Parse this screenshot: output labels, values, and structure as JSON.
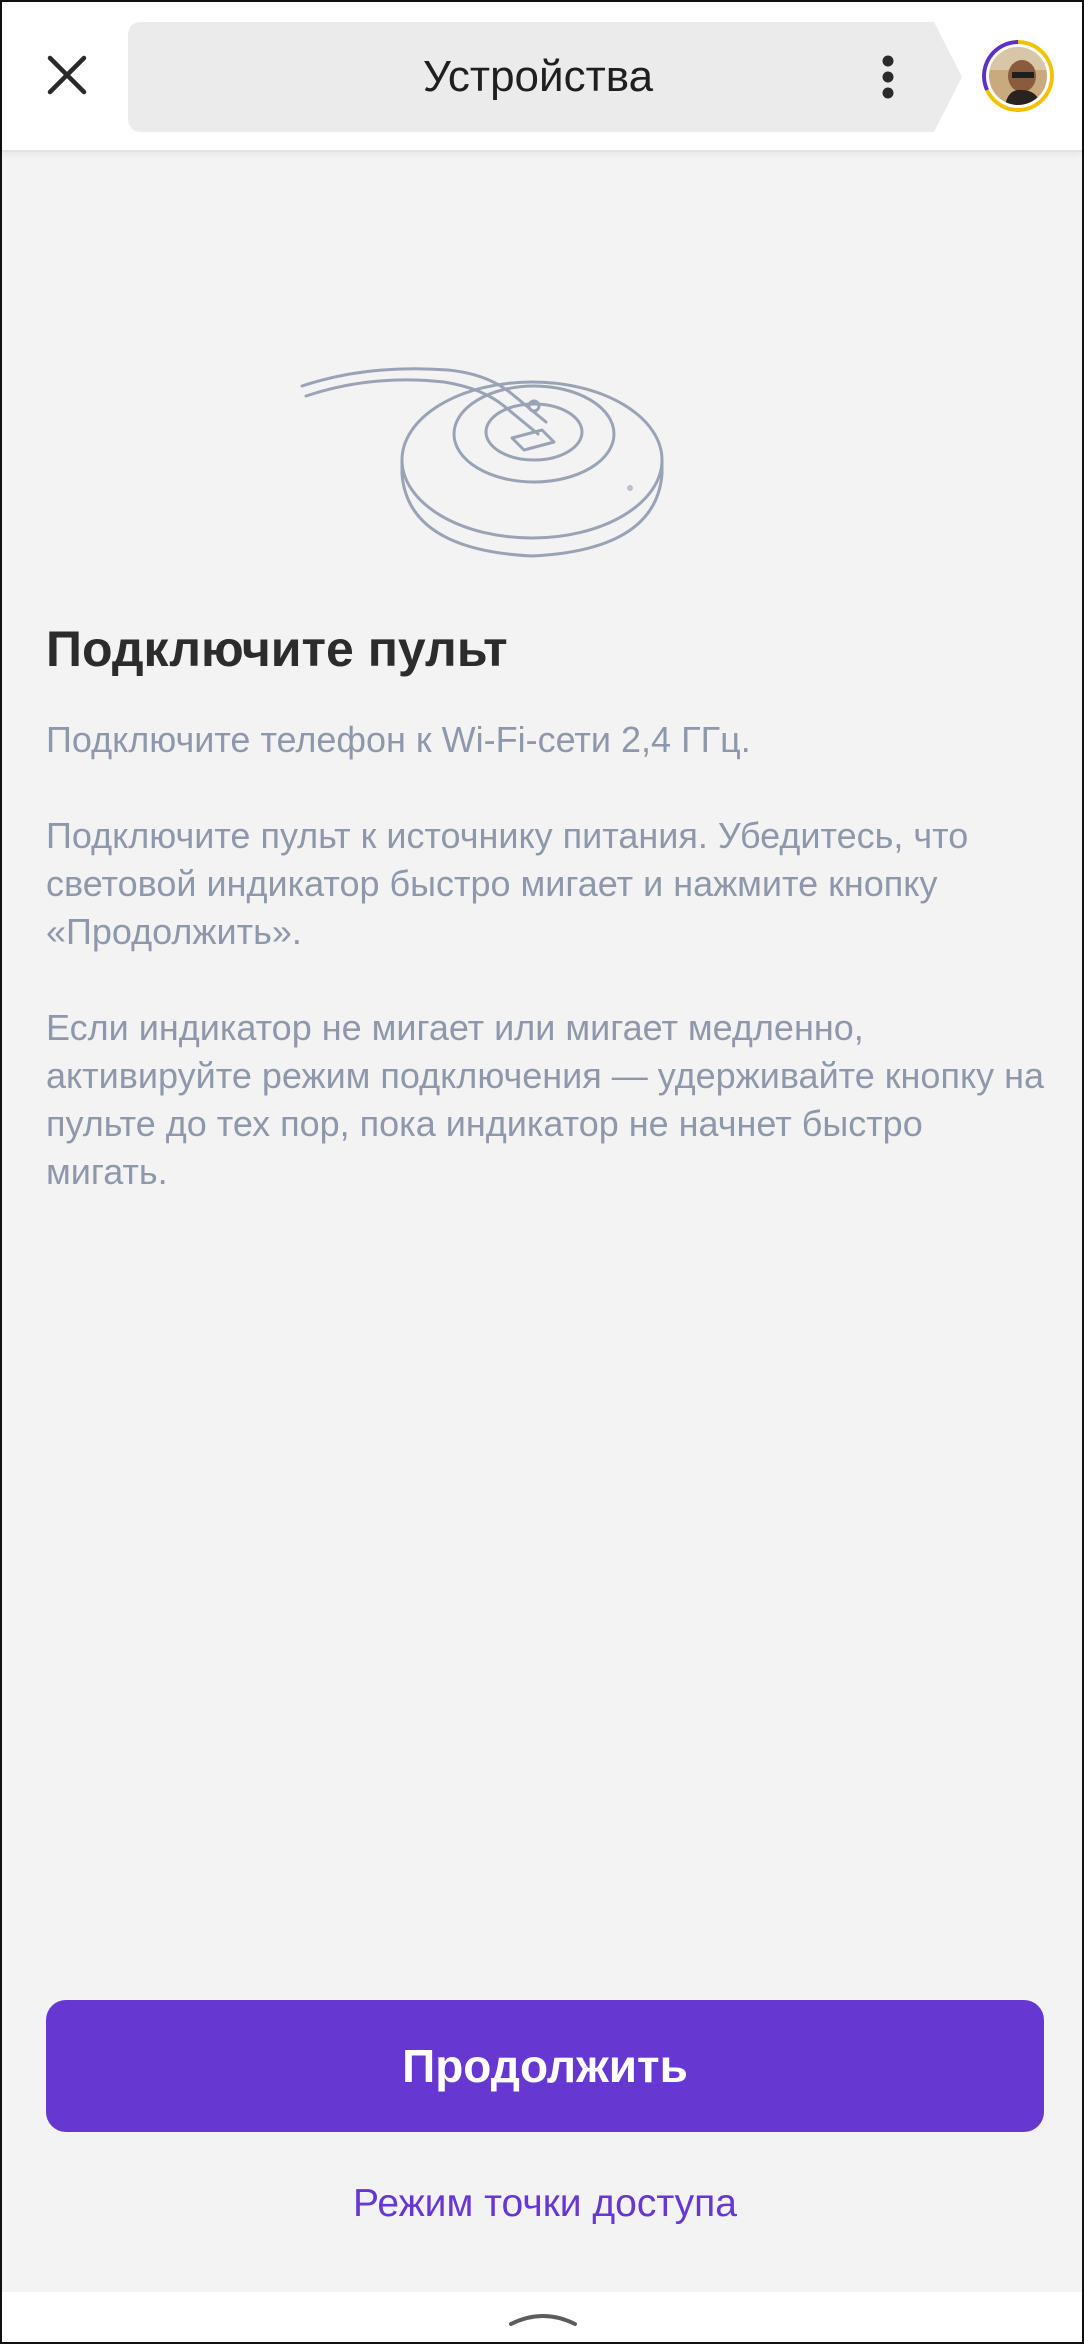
{
  "header": {
    "title": "Устройства",
    "close_icon": "close-icon",
    "more_icon": "more-vertical-icon",
    "avatar": "user-avatar"
  },
  "main": {
    "illustration": "remote-hub-illustration",
    "heading": "Подключите пульт",
    "paragraphs": [
      "Подключите телефон к Wi-Fi-сети 2,4 ГГц.",
      "Подключите пульт к источнику питания. Убедитесь, что световой индикатор быстро мигает и нажмите кнопку «Продолжить».",
      "Если индикатор не мигает или мигает медленно, активируйте режим подключения — удерживайте кнопку на пульте до тех пор, пока индикатор не начнет быстро мигать."
    ]
  },
  "actions": {
    "continue_label": "Продолжить",
    "access_point_label": "Режим точки доступа"
  },
  "bottom": {
    "handle_icon": "chevron-up-icon"
  },
  "colors": {
    "accent": "#6637d1",
    "text_secondary": "#8f97ab",
    "background": "#f3f3f3"
  }
}
